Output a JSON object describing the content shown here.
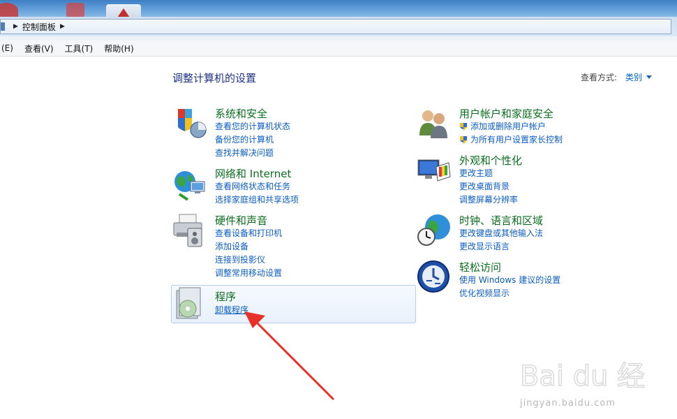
{
  "addressbar": {
    "path": "控制面板"
  },
  "menu": [
    "(E)",
    "查看(V)",
    "工具(T)",
    "帮助(H)"
  ],
  "page_title": "调整计算机的设置",
  "view": {
    "label": "查看方式:",
    "value": "类别"
  },
  "categories": [
    {
      "title": "系统和安全",
      "icon": "shield-pie-icon",
      "links": [
        "查看您的计算机状态",
        "备份您的计算机",
        "查找并解决问题"
      ]
    },
    {
      "title": "网络和 Internet",
      "icon": "network-globe-icon",
      "links": [
        "查看网络状态和任务",
        "选择家庭组和共享选项"
      ]
    },
    {
      "title": "硬件和声音",
      "icon": "printer-speaker-icon",
      "links": [
        "查看设备和打印机",
        "添加设备",
        "连接到投影仪",
        "调整常用移动设置"
      ]
    },
    {
      "title": "程序",
      "icon": "program-disc-icon",
      "links": [
        "卸载程序"
      ]
    },
    {
      "title": "用户帐户和家庭安全",
      "icon": "users-icon",
      "links": [
        "添加或删除用户帐户",
        "为所有用户设置家长控制"
      ]
    },
    {
      "title": "外观和个性化",
      "icon": "display-palette-icon",
      "links": [
        "更改主题",
        "更改桌面背景",
        "调整屏幕分辨率"
      ]
    },
    {
      "title": "时钟、语言和区域",
      "icon": "clock-globe-icon",
      "links": [
        "更改键盘或其他输入法",
        "更改显示语言"
      ]
    },
    {
      "title": "轻松访问",
      "icon": "ease-of-access-icon",
      "links": [
        "使用 Windows 建议的设置",
        "优化视频显示"
      ]
    }
  ],
  "watermark": {
    "brand": "Bai du 经验",
    "url": "jingyan.baidu.com"
  },
  "colors": {
    "category_title": "#0a6e1e",
    "link": "#0b5dc4",
    "page_title": "#1e3287",
    "arrow": "#e8302a"
  }
}
